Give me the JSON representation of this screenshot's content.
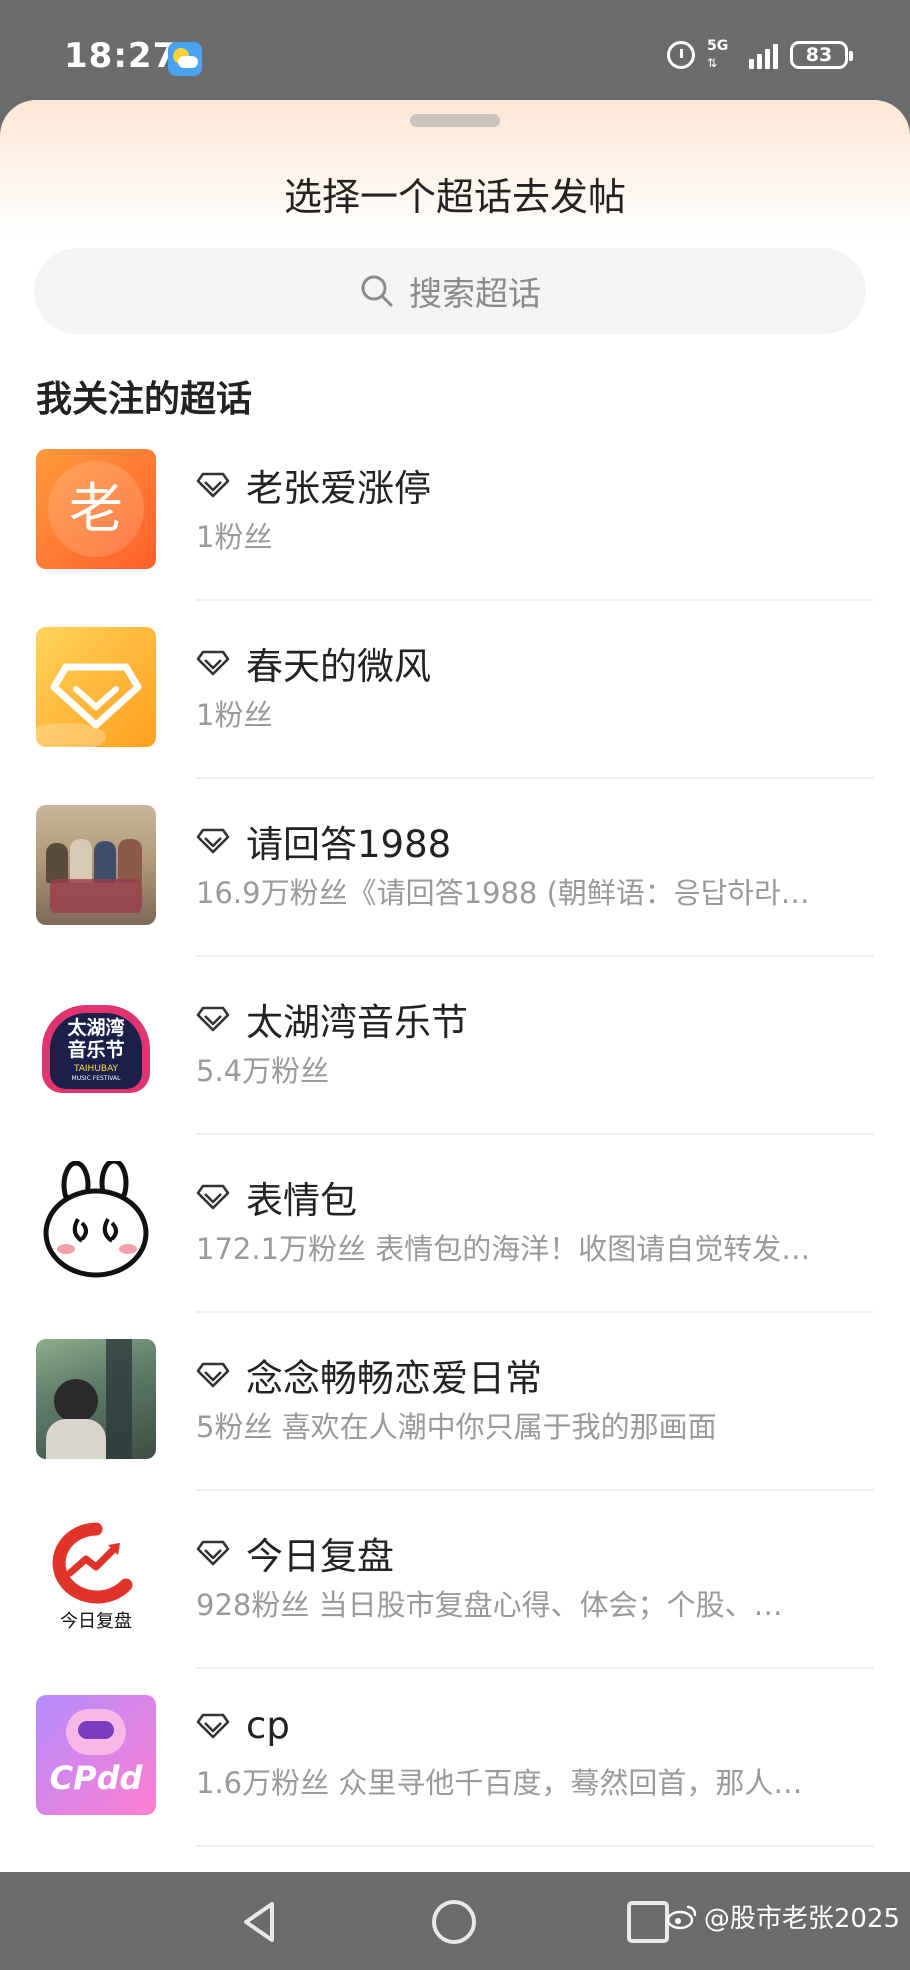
{
  "status_bar": {
    "time": "18:27",
    "network": "5G",
    "battery": "83"
  },
  "sheet": {
    "title": "选择一个超话去发帖",
    "search_placeholder": "搜索超话",
    "section_title": "我关注的超话"
  },
  "topics": [
    {
      "name": "老张爱涨停",
      "desc": "1粉丝",
      "avatar_char": "老"
    },
    {
      "name": "春天的微风",
      "desc": "1粉丝"
    },
    {
      "name": "请回答1988",
      "desc": "16.9万粉丝《请回答1988 (朝鲜语：응답하라…"
    },
    {
      "name": "太湖湾音乐节",
      "desc": "5.4万粉丝",
      "avatar_lines": [
        "太湖湾",
        "音乐节",
        "TAIHUBAY",
        "MUSIC FESTIVAL"
      ]
    },
    {
      "name": "表情包",
      "desc": "172.1万粉丝 表情包的海洋！收图请自觉转发…"
    },
    {
      "name": "念念畅畅恋爱日常",
      "desc": "5粉丝 喜欢在人潮中你只属于我的那画面"
    },
    {
      "name": "今日复盘",
      "desc": "928粉丝 当日股市复盘心得、体会；个股、…",
      "avatar_caption": "今日复盘"
    },
    {
      "name": "cp",
      "desc": "1.6万粉丝 众里寻他千百度，蓦然回首，那人…",
      "avatar_text": "CPdd"
    }
  ],
  "watermark": "@股市老张2025",
  "colors": {
    "accent_orange": "#ff7a2f",
    "grey_text": "#9a9a9a"
  },
  "icons": [
    "weather-icon",
    "alarm-icon",
    "signal-icon",
    "battery-icon",
    "search-icon",
    "diamond-icon",
    "back-icon",
    "home-icon",
    "recents-icon",
    "weibo-icon"
  ]
}
